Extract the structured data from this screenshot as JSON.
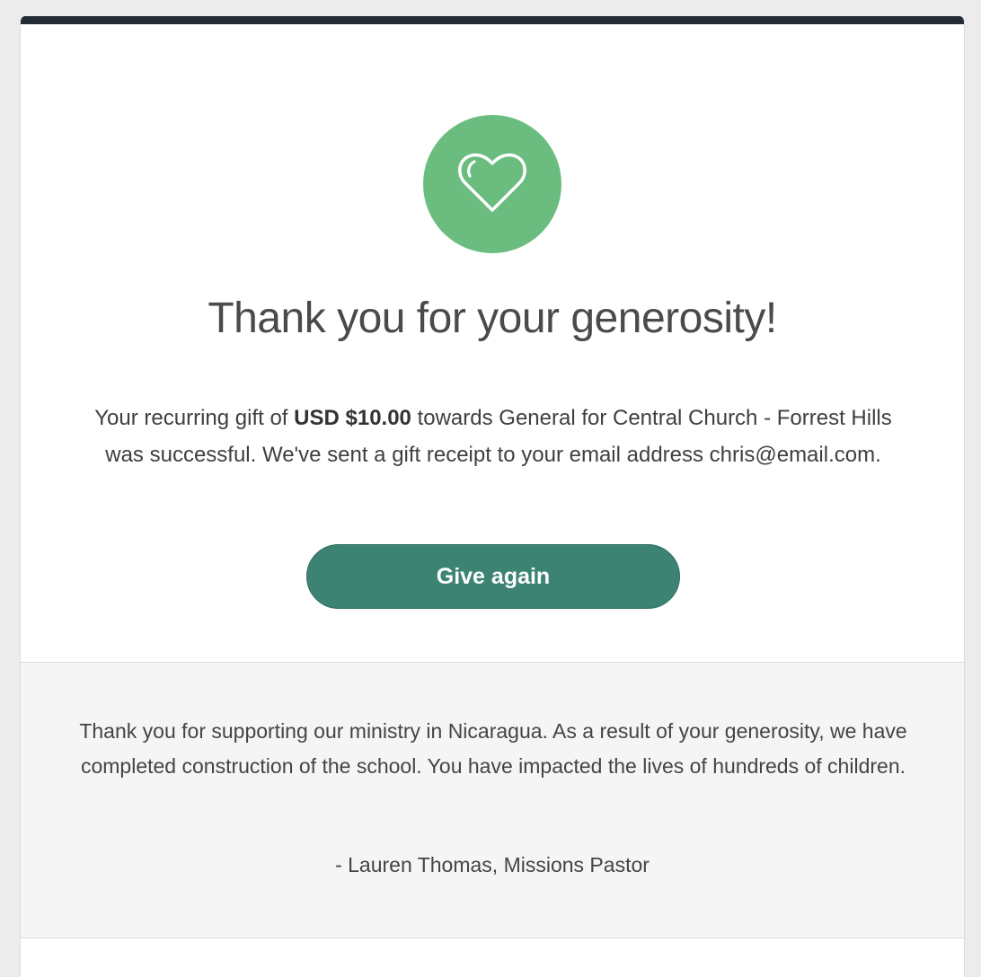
{
  "confirmation": {
    "title": "Thank you for your generosity!",
    "message_prefix": "Your recurring gift of ",
    "amount": "USD $10.00",
    "message_suffix": " towards General for Central Church - Forrest Hills was successful. We've sent a gift receipt to your email address chris@email.com.",
    "give_again_label": "Give again",
    "icon": "heart-icon",
    "accent_color": "#6abd7f",
    "button_color": "#3d8374"
  },
  "pastor_note": {
    "text": "Thank you for supporting our ministry in Nicaragua. As a result of your generosity, we have completed construction of the school. You have impacted the lives of hundreds of children.",
    "signature": "- Lauren Thomas, Missions Pastor"
  }
}
